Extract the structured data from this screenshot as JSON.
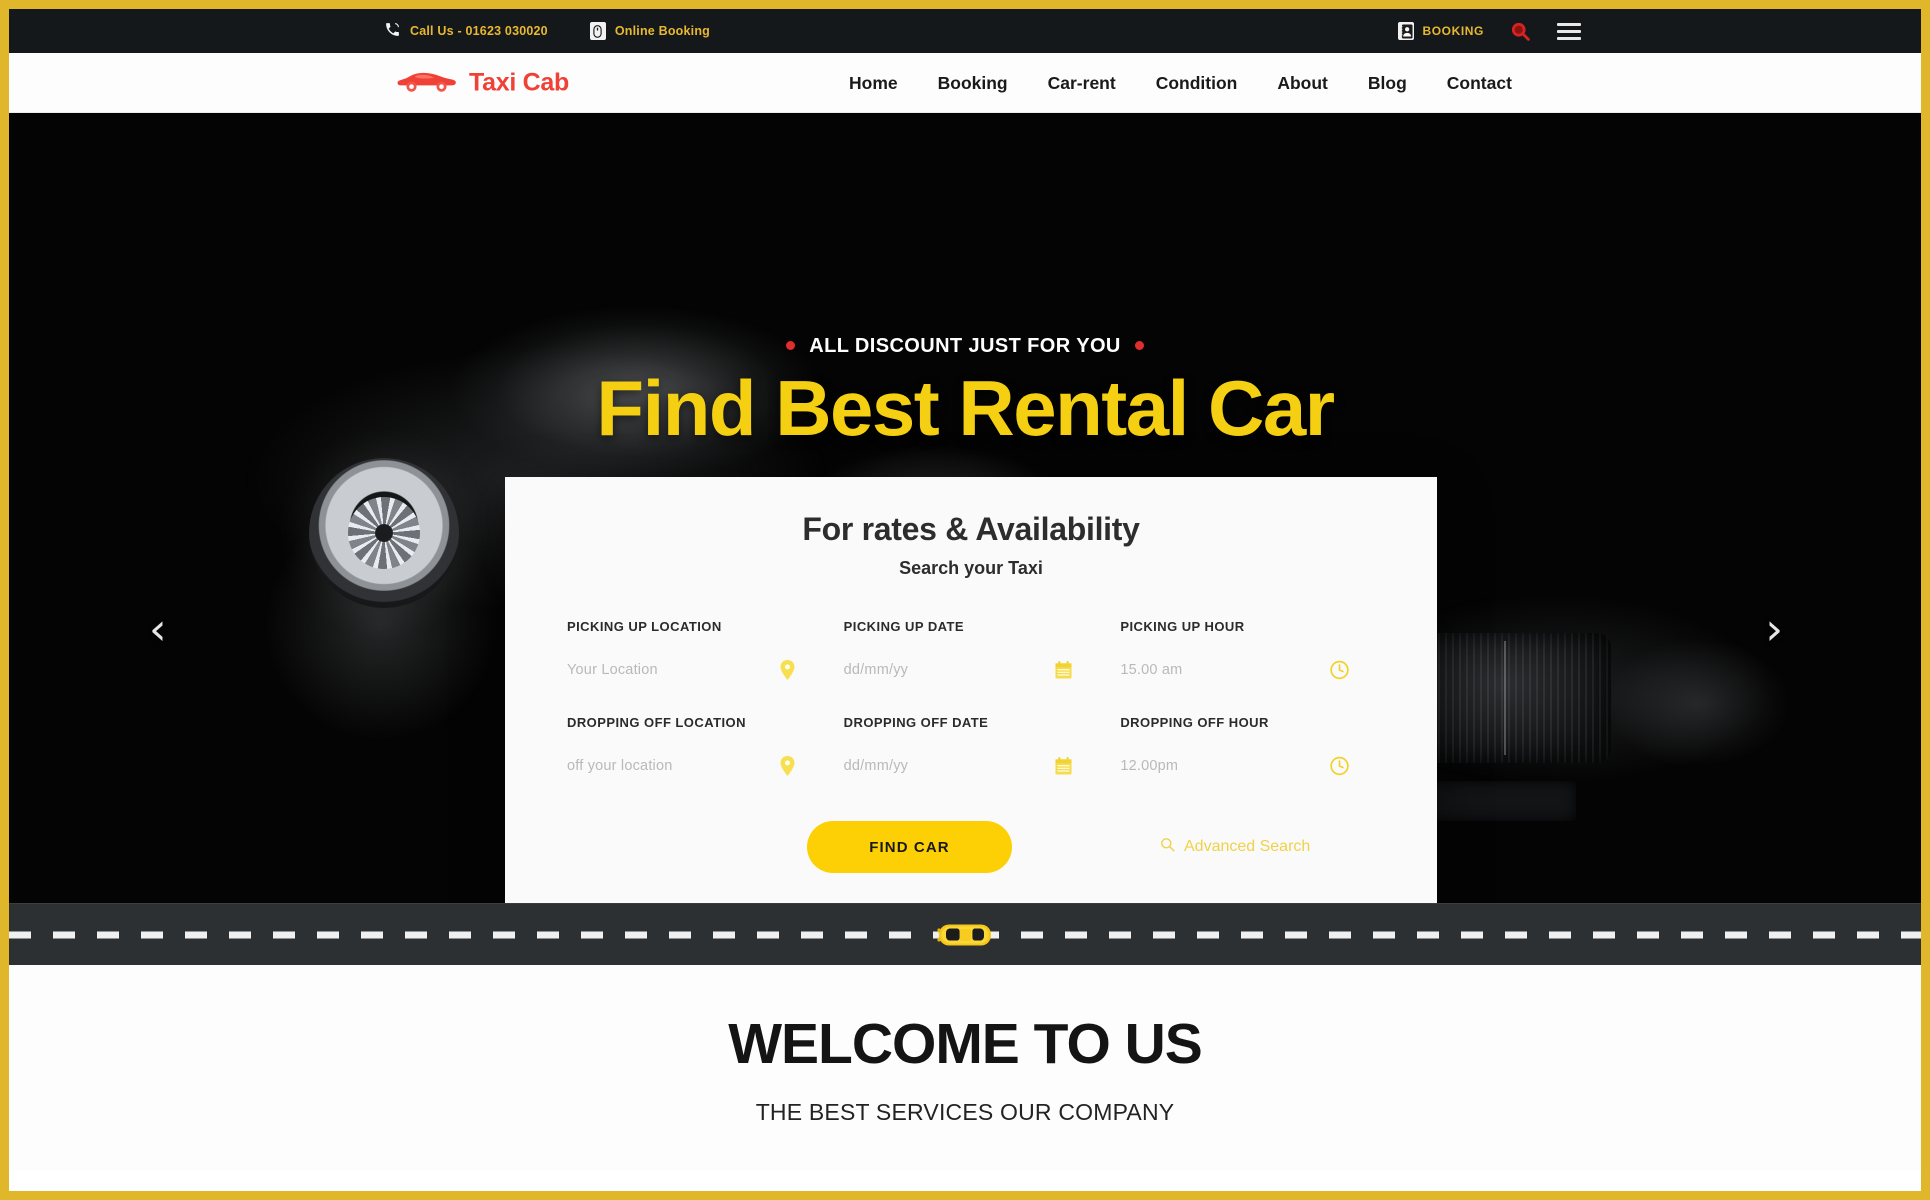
{
  "theme": {
    "frame_gold": "#e0b62a",
    "accent_yellow": "#fdd005",
    "hero_title_yellow": "#f5cf12",
    "brand_red": "#ef4136",
    "topbar_bg": "#15181b",
    "road_bg": "#2c3033"
  },
  "topbar": {
    "phone": {
      "icon": "phone-icon",
      "label": "Call Us - 01623 030020"
    },
    "online_booking": {
      "icon": "mouse-icon",
      "label": "Online Booking"
    },
    "booking": {
      "icon": "contact-card-icon",
      "label": "BOOKING"
    },
    "search_icon": "search-icon",
    "menu_icon": "hamburger-menu-icon"
  },
  "header": {
    "logo": {
      "icon": "red-car-icon",
      "text": "Taxi Cab"
    },
    "nav": [
      {
        "label": "Home"
      },
      {
        "label": "Booking"
      },
      {
        "label": "Car-rent"
      },
      {
        "label": "Condition"
      },
      {
        "label": "About"
      },
      {
        "label": "Blog"
      },
      {
        "label": "Contact"
      }
    ]
  },
  "hero": {
    "kicker": "ALL DISCOUNT JUST FOR YOU",
    "title": "Find Best Rental Car",
    "prev_arrow": "‹",
    "next_arrow": "›"
  },
  "booking_form": {
    "title": "For rates & Availability",
    "subtitle": "Search your Taxi",
    "fields": [
      {
        "label": "PICKING UP LOCATION",
        "placeholder": "Your Location",
        "icon": "map-pin-icon"
      },
      {
        "label": "PICKING UP DATE",
        "placeholder": "dd/mm/yy",
        "icon": "calendar-icon"
      },
      {
        "label": "PICKING UP HOUR",
        "placeholder": "15.00 am",
        "icon": "clock-icon"
      },
      {
        "label": "DROPPING OFF LOCATION",
        "placeholder": "off your location",
        "icon": "map-pin-icon"
      },
      {
        "label": "DROPPING OFF DATE",
        "placeholder": "dd/mm/yy",
        "icon": "calendar-icon"
      },
      {
        "label": "DROPPING OFF HOUR",
        "placeholder": "12.00pm",
        "icon": "clock-icon"
      }
    ],
    "submit_label": "FIND CAR",
    "advanced_search_label": "Advanced Search",
    "advanced_search_icon": "search-icon"
  },
  "road": {
    "taxi_icon": "yellow-taxi-top-view-icon"
  },
  "welcome": {
    "heading": "WELCOME TO US",
    "subheading": "THE BEST SERVICES OUR COMPANY"
  }
}
